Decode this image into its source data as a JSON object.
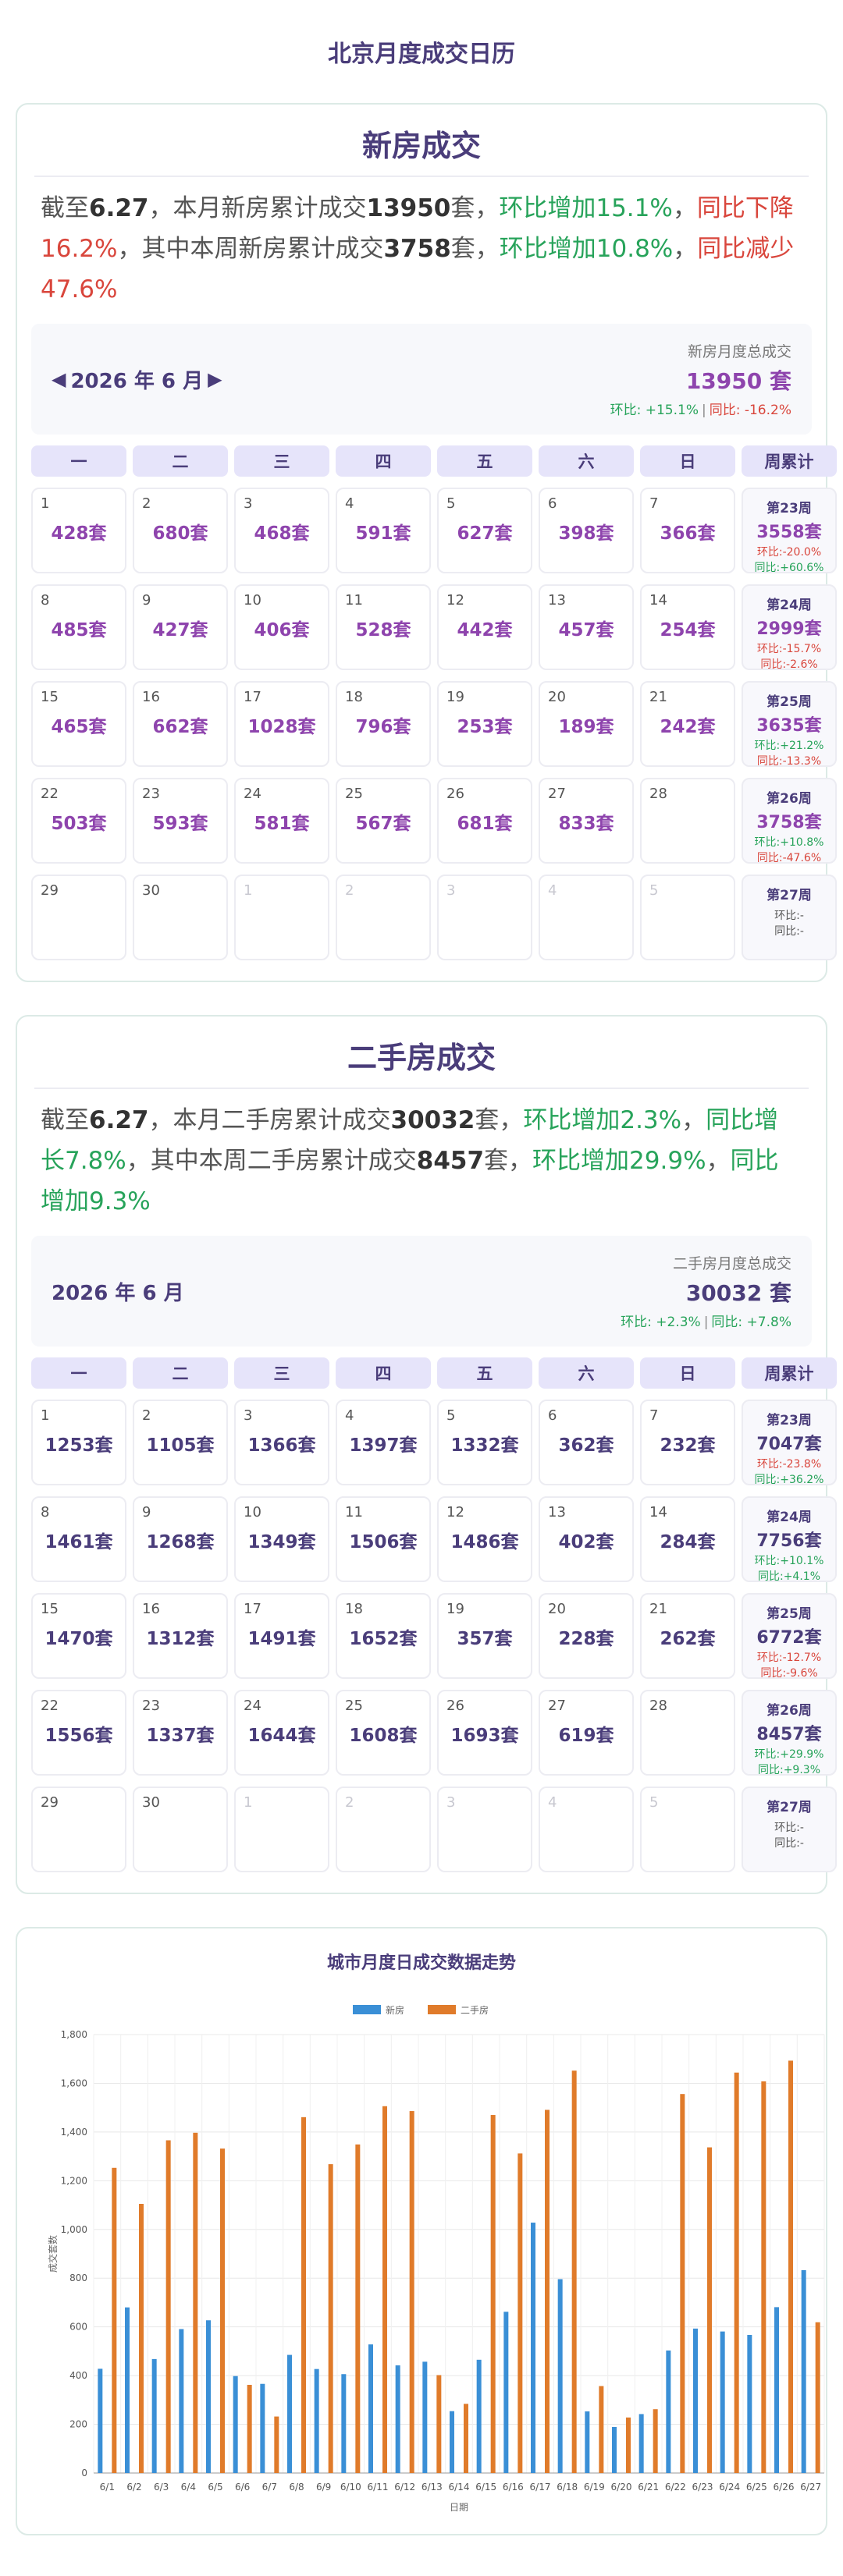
{
  "page_title": "北京月度成交日历",
  "weekdays": [
    "一",
    "二",
    "三",
    "四",
    "五",
    "六",
    "日"
  ],
  "week_col_label": "周累计",
  "new_house": {
    "title": "新房成交",
    "summary": {
      "p1": "截至",
      "date": "6.27",
      "p2": "，本月新房累计成交",
      "month_total": "13950",
      "p3": "套，",
      "mom": "环比增加15.1%",
      "p4": "，",
      "yoy": "同比下降16.2%",
      "p5": "，其中本周新房累计成交",
      "week_total": "3758",
      "p6": "套，",
      "wmom": "环比增加10.8%",
      "p7": "，",
      "wyoy": "同比减少47.6%"
    },
    "month_label": "2026 年 6 月",
    "prev_icon": "triangle-left-icon",
    "next_icon": "triangle-right-icon",
    "total_title": "新房月度总成交",
    "total_value": "13950 套",
    "mom": "环比: +15.1%",
    "sep": "|",
    "yoy": "同比: -16.2%",
    "weeks": [
      {
        "days": [
          {
            "n": "1",
            "v": "428套"
          },
          {
            "n": "2",
            "v": "680套"
          },
          {
            "n": "3",
            "v": "468套"
          },
          {
            "n": "4",
            "v": "591套"
          },
          {
            "n": "5",
            "v": "627套"
          },
          {
            "n": "6",
            "v": "398套"
          },
          {
            "n": "7",
            "v": "366套"
          }
        ],
        "wk": "第23周",
        "total": "3558套",
        "mom": "环比:-20.0%",
        "yoy": "同比:+60.6%",
        "mom_c": "red",
        "yoy_c": "green"
      },
      {
        "days": [
          {
            "n": "8",
            "v": "485套"
          },
          {
            "n": "9",
            "v": "427套"
          },
          {
            "n": "10",
            "v": "406套"
          },
          {
            "n": "11",
            "v": "528套"
          },
          {
            "n": "12",
            "v": "442套"
          },
          {
            "n": "13",
            "v": "457套"
          },
          {
            "n": "14",
            "v": "254套"
          }
        ],
        "wk": "第24周",
        "total": "2999套",
        "mom": "环比:-15.7%",
        "yoy": "同比:-2.6%",
        "mom_c": "red",
        "yoy_c": "red"
      },
      {
        "days": [
          {
            "n": "15",
            "v": "465套"
          },
          {
            "n": "16",
            "v": "662套"
          },
          {
            "n": "17",
            "v": "1028套"
          },
          {
            "n": "18",
            "v": "796套"
          },
          {
            "n": "19",
            "v": "253套"
          },
          {
            "n": "20",
            "v": "189套"
          },
          {
            "n": "21",
            "v": "242套"
          }
        ],
        "wk": "第25周",
        "total": "3635套",
        "mom": "环比:+21.2%",
        "yoy": "同比:-13.3%",
        "mom_c": "green",
        "yoy_c": "red"
      },
      {
        "days": [
          {
            "n": "22",
            "v": "503套"
          },
          {
            "n": "23",
            "v": "593套"
          },
          {
            "n": "24",
            "v": "581套"
          },
          {
            "n": "25",
            "v": "567套"
          },
          {
            "n": "26",
            "v": "681套"
          },
          {
            "n": "27",
            "v": "833套"
          },
          {
            "n": "28",
            "v": ""
          }
        ],
        "wk": "第26周",
        "total": "3758套",
        "mom": "环比:+10.8%",
        "yoy": "同比:-47.6%",
        "mom_c": "green",
        "yoy_c": "red"
      },
      {
        "days": [
          {
            "n": "29",
            "v": ""
          },
          {
            "n": "30",
            "v": ""
          },
          {
            "n": "1",
            "v": "",
            "out": true
          },
          {
            "n": "2",
            "v": "",
            "out": true
          },
          {
            "n": "3",
            "v": "",
            "out": true
          },
          {
            "n": "4",
            "v": "",
            "out": true
          },
          {
            "n": "5",
            "v": "",
            "out": true
          }
        ],
        "wk": "第27周",
        "total": "",
        "mom": "环比:-",
        "yoy": "同比:-",
        "mom_c": "gray",
        "yoy_c": "gray"
      }
    ]
  },
  "second_house": {
    "title": "二手房成交",
    "summary": {
      "p1": "截至",
      "date": "6.27",
      "p2": "，本月二手房累计成交",
      "month_total": "30032",
      "p3": "套，",
      "mom": "环比增加2.3%",
      "p4": "，",
      "yoy": "同比增长7.8%",
      "p5": "，其中本周二手房累计成交",
      "week_total": "8457",
      "p6": "套，",
      "wmom": "环比增加29.9%",
      "p7": "，",
      "wyoy": "同比增加9.3%"
    },
    "month_label": "2026 年 6 月",
    "total_title": "二手房月度总成交",
    "total_value": "30032 套",
    "mom": "环比: +2.3%",
    "sep": "|",
    "yoy": "同比: +7.8%",
    "weeks": [
      {
        "days": [
          {
            "n": "1",
            "v": "1253套"
          },
          {
            "n": "2",
            "v": "1105套"
          },
          {
            "n": "3",
            "v": "1366套"
          },
          {
            "n": "4",
            "v": "1397套"
          },
          {
            "n": "5",
            "v": "1332套"
          },
          {
            "n": "6",
            "v": "362套"
          },
          {
            "n": "7",
            "v": "232套"
          }
        ],
        "wk": "第23周",
        "total": "7047套",
        "mom": "环比:-23.8%",
        "yoy": "同比:+36.2%",
        "mom_c": "red",
        "yoy_c": "green"
      },
      {
        "days": [
          {
            "n": "8",
            "v": "1461套"
          },
          {
            "n": "9",
            "v": "1268套"
          },
          {
            "n": "10",
            "v": "1349套"
          },
          {
            "n": "11",
            "v": "1506套"
          },
          {
            "n": "12",
            "v": "1486套"
          },
          {
            "n": "13",
            "v": "402套"
          },
          {
            "n": "14",
            "v": "284套"
          }
        ],
        "wk": "第24周",
        "total": "7756套",
        "mom": "环比:+10.1%",
        "yoy": "同比:+4.1%",
        "mom_c": "green",
        "yoy_c": "green"
      },
      {
        "days": [
          {
            "n": "15",
            "v": "1470套"
          },
          {
            "n": "16",
            "v": "1312套"
          },
          {
            "n": "17",
            "v": "1491套"
          },
          {
            "n": "18",
            "v": "1652套"
          },
          {
            "n": "19",
            "v": "357套"
          },
          {
            "n": "20",
            "v": "228套"
          },
          {
            "n": "21",
            "v": "262套"
          }
        ],
        "wk": "第25周",
        "total": "6772套",
        "mom": "环比:-12.7%",
        "yoy": "同比:-9.6%",
        "mom_c": "red",
        "yoy_c": "red"
      },
      {
        "days": [
          {
            "n": "22",
            "v": "1556套"
          },
          {
            "n": "23",
            "v": "1337套"
          },
          {
            "n": "24",
            "v": "1644套"
          },
          {
            "n": "25",
            "v": "1608套"
          },
          {
            "n": "26",
            "v": "1693套"
          },
          {
            "n": "27",
            "v": "619套"
          },
          {
            "n": "28",
            "v": ""
          }
        ],
        "wk": "第26周",
        "total": "8457套",
        "mom": "环比:+29.9%",
        "yoy": "同比:+9.3%",
        "mom_c": "green",
        "yoy_c": "green"
      },
      {
        "days": [
          {
            "n": "29",
            "v": ""
          },
          {
            "n": "30",
            "v": ""
          },
          {
            "n": "1",
            "v": "",
            "out": true
          },
          {
            "n": "2",
            "v": "",
            "out": true
          },
          {
            "n": "3",
            "v": "",
            "out": true
          },
          {
            "n": "4",
            "v": "",
            "out": true
          },
          {
            "n": "5",
            "v": "",
            "out": true
          }
        ],
        "wk": "第27周",
        "total": "",
        "mom": "环比:-",
        "yoy": "同比:-",
        "mom_c": "gray",
        "yoy_c": "gray"
      }
    ]
  },
  "colors": {
    "new": "#3a8fd6",
    "second": "#e07b2a",
    "green": "#27a35a",
    "red": "#d9463c"
  },
  "chart_data": {
    "type": "bar",
    "title": "城市月度日成交数据走势",
    "xlabel": "日期",
    "ylabel": "成交套数",
    "ylim": [
      0,
      1800
    ],
    "yticks": [
      "0",
      "200",
      "400",
      "600",
      "800",
      "1,000",
      "1,200",
      "1,400",
      "1,600",
      "1,800"
    ],
    "grid": true,
    "legend": "top-center",
    "categories": [
      "6/1",
      "6/2",
      "6/3",
      "6/4",
      "6/5",
      "6/6",
      "6/7",
      "6/8",
      "6/9",
      "6/10",
      "6/11",
      "6/12",
      "6/13",
      "6/14",
      "6/15",
      "6/16",
      "6/17",
      "6/18",
      "6/19",
      "6/20",
      "6/21",
      "6/22",
      "6/23",
      "6/24",
      "6/25",
      "6/26",
      "6/27"
    ],
    "series": [
      {
        "name": "新房",
        "color": "#3a8fd6",
        "values": [
          428,
          680,
          468,
          591,
          627,
          398,
          366,
          485,
          427,
          406,
          528,
          442,
          457,
          254,
          465,
          662,
          1028,
          796,
          253,
          189,
          242,
          503,
          593,
          581,
          567,
          681,
          833
        ]
      },
      {
        "name": "二手房",
        "color": "#e07b2a",
        "values": [
          1253,
          1105,
          1366,
          1397,
          1332,
          362,
          232,
          1461,
          1268,
          1349,
          1506,
          1486,
          402,
          284,
          1470,
          1312,
          1491,
          1652,
          357,
          228,
          262,
          1556,
          1337,
          1644,
          1608,
          1693,
          619
        ]
      }
    ]
  }
}
